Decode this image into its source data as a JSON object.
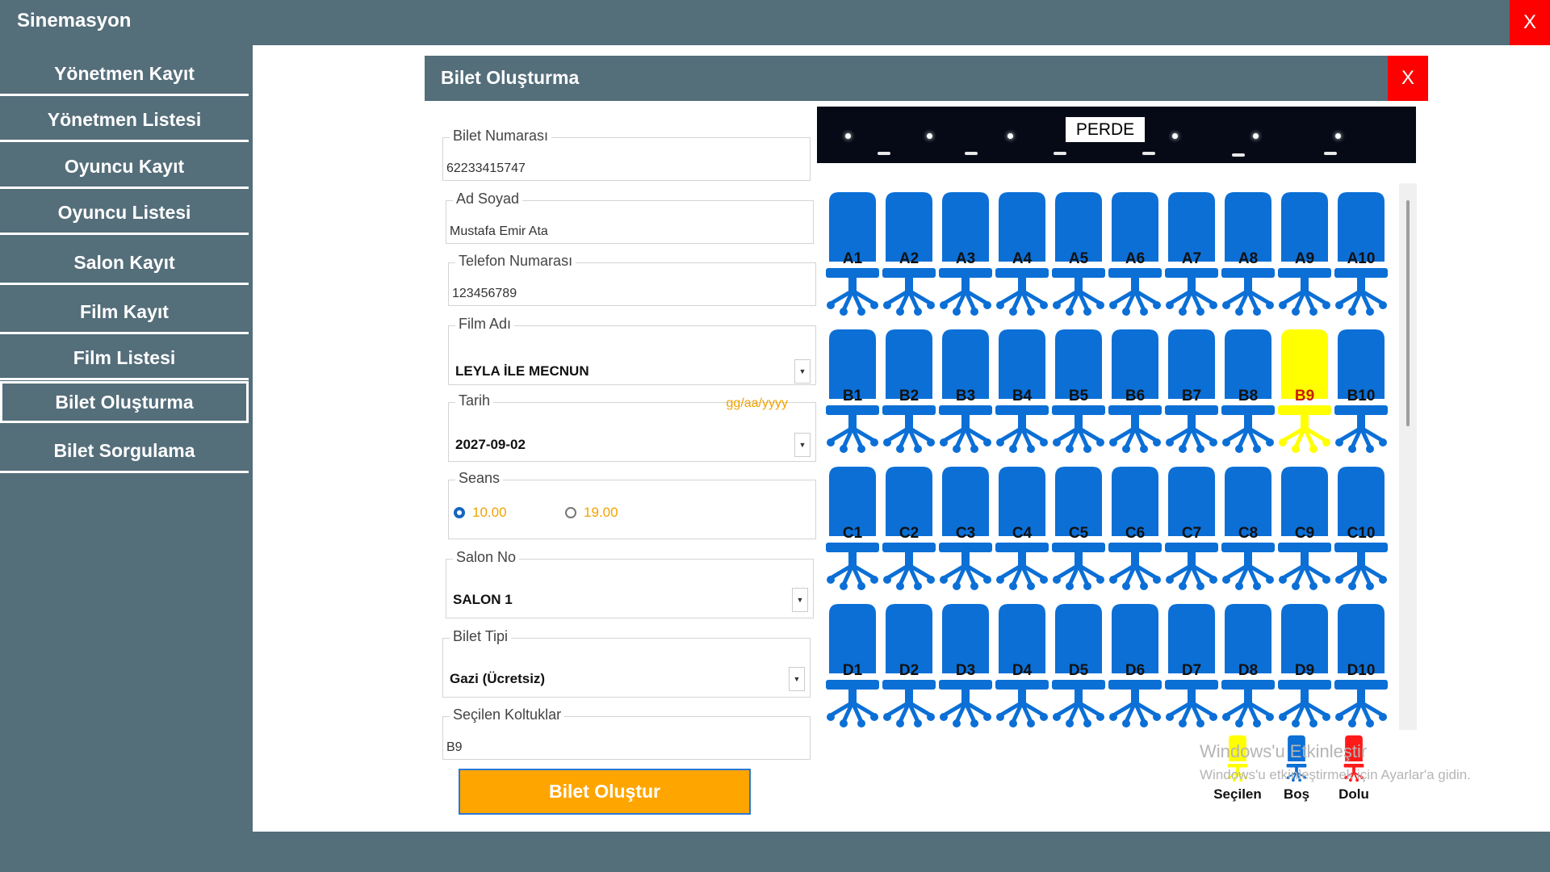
{
  "app": {
    "title": "Sinemasyon",
    "close_label": "X"
  },
  "sidebar": {
    "items": [
      {
        "label": "Yönetmen Kayıt"
      },
      {
        "label": "Yönetmen Listesi"
      },
      {
        "label": "Oyuncu Kayıt"
      },
      {
        "label": "Oyuncu Listesi"
      },
      {
        "label": "Salon Kayıt"
      },
      {
        "label": "Film Kayıt"
      },
      {
        "label": "Film Listesi"
      },
      {
        "label": "Bilet Oluşturma",
        "active": true
      },
      {
        "label": "Bilet Sorgulama"
      }
    ]
  },
  "dialog": {
    "title": "Bilet Oluşturma",
    "close_label": "X"
  },
  "form": {
    "ticket_number": {
      "label": "Bilet Numarası",
      "value": "62233415747"
    },
    "full_name": {
      "label": "Ad Soyad",
      "value": "Mustafa Emir Ata"
    },
    "phone": {
      "label": "Telefon Numarası",
      "value": "123456789"
    },
    "film": {
      "label": "Film Adı",
      "value": "LEYLA İLE MECNUN"
    },
    "date": {
      "label": "Tarih",
      "hint": "gg/aa/yyyy",
      "value": "2027-09-02"
    },
    "session": {
      "label": "Seans",
      "options": [
        "10.00",
        "19.00"
      ],
      "selected": "10.00"
    },
    "hall": {
      "label": "Salon No",
      "value": "SALON 1"
    },
    "ticket_type": {
      "label": "Bilet Tipi",
      "value": "Gazi (Ücretsiz)"
    },
    "selected_seats": {
      "label": "Seçilen Koltuklar",
      "value": "B9"
    },
    "submit_label": "Bilet Oluştur"
  },
  "screen": {
    "label": "PERDE"
  },
  "seats": {
    "rows": [
      "A",
      "B",
      "C",
      "D"
    ],
    "cols": 10,
    "selected": [
      "B9"
    ],
    "occupied": []
  },
  "legend": [
    {
      "label": "Seçilen",
      "color": "#ffff00"
    },
    {
      "label": "Boş",
      "color": "#0b6fd6"
    },
    {
      "label": "Dolu",
      "color": "#ff1a1a"
    }
  ],
  "colors": {
    "seat_empty": "#0b6fd6",
    "seat_selected": "#ffff00",
    "seat_full": "#ff1a1a",
    "accent": "#ffa500",
    "chrome": "#546e7a"
  },
  "watermark": {
    "line1": "Windows'u Etkinleştir",
    "line2": "Windows'u etkinleştirmek için Ayarlar'a gidin."
  }
}
